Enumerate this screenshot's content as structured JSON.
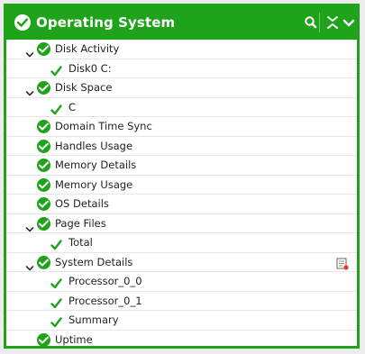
{
  "panel": {
    "title": "Operating System",
    "status": "ok",
    "colors": {
      "accent": "#1fa31a",
      "ok": "#1fa31a",
      "text": "#222222"
    },
    "header_icons": [
      "search-icon",
      "collapse-all-icon",
      "chevron-down-icon"
    ]
  },
  "tree": [
    {
      "label": "Disk Activity",
      "level": 0,
      "expanded": true,
      "status": "ok"
    },
    {
      "label": "Disk0 C:",
      "level": 1,
      "status": "ok"
    },
    {
      "label": "Disk Space",
      "level": 0,
      "expanded": true,
      "status": "ok"
    },
    {
      "label": "C",
      "level": 1,
      "status": "ok"
    },
    {
      "label": "Domain Time Sync",
      "level": 0,
      "status": "ok"
    },
    {
      "label": "Handles Usage",
      "level": 0,
      "status": "ok"
    },
    {
      "label": "Memory Details",
      "level": 0,
      "status": "ok"
    },
    {
      "label": "Memory Usage",
      "level": 0,
      "status": "ok"
    },
    {
      "label": "OS Details",
      "level": 0,
      "status": "ok"
    },
    {
      "label": "Page Files",
      "level": 0,
      "expanded": true,
      "status": "ok"
    },
    {
      "label": "Total",
      "level": 1,
      "status": "ok"
    },
    {
      "label": "System Details",
      "level": 0,
      "expanded": true,
      "status": "ok",
      "action_icon": "report-icon"
    },
    {
      "label": "Processor_0_0",
      "level": 1,
      "status": "ok"
    },
    {
      "label": "Processor_0_1",
      "level": 1,
      "status": "ok"
    },
    {
      "label": "Summary",
      "level": 1,
      "status": "ok"
    },
    {
      "label": "Uptime",
      "level": 0,
      "status": "ok"
    }
  ]
}
